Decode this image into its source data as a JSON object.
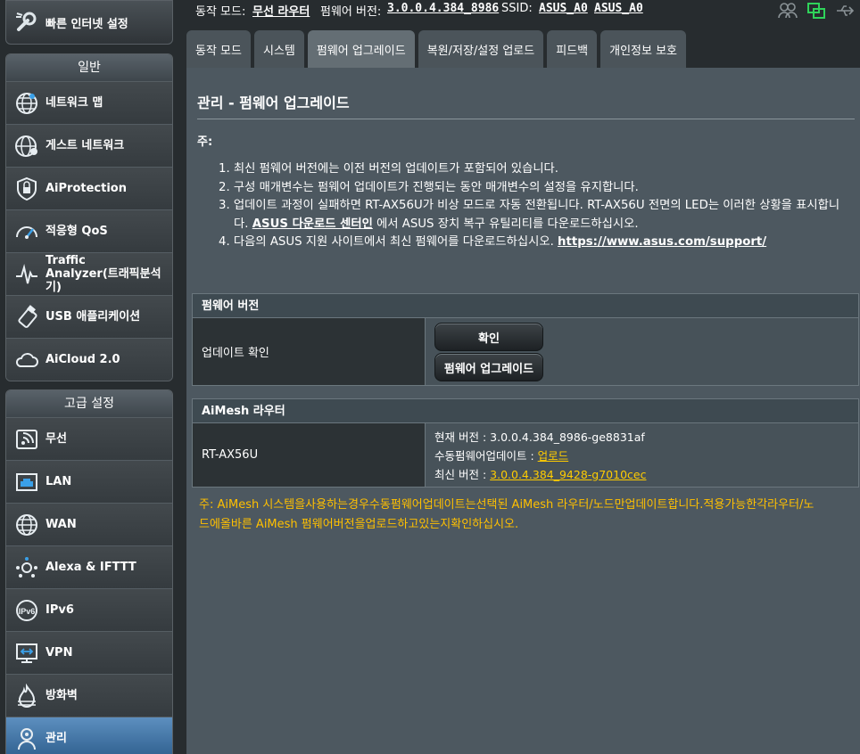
{
  "sidebar": {
    "quick_setup": "빠른 인터넷 설정",
    "general": {
      "title": "일반",
      "items": [
        {
          "label": "네트워크 맵",
          "icon": "network-map-icon"
        },
        {
          "label": "게스트 네트워크",
          "icon": "guest-network-icon"
        },
        {
          "label": "AiProtection",
          "icon": "shield-icon"
        },
        {
          "label": "적응형 QoS",
          "icon": "qos-gauge-icon"
        },
        {
          "label_line1": "Traffic",
          "label_line2": "Analyzer(트래픽분석기)",
          "icon": "traffic-analyzer-icon"
        },
        {
          "label": "USB 애플리케이션",
          "icon": "usb-icon"
        },
        {
          "label": "AiCloud 2.0",
          "icon": "cloud-icon"
        }
      ]
    },
    "advanced": {
      "title": "고급 설정",
      "items": [
        {
          "label": "무선",
          "icon": "wireless-icon"
        },
        {
          "label": "LAN",
          "icon": "lan-icon"
        },
        {
          "label": "WAN",
          "icon": "wan-globe-icon"
        },
        {
          "label": "Alexa & IFTTT",
          "icon": "alexa-ifttt-icon"
        },
        {
          "label": "IPv6",
          "icon": "ipv6-icon"
        },
        {
          "label": "VPN",
          "icon": "vpn-icon"
        },
        {
          "label": "방화벽",
          "icon": "firewall-icon"
        },
        {
          "label": "관리",
          "icon": "administration-icon"
        }
      ]
    }
  },
  "topbar": {
    "mode_label": "동작 모드:",
    "mode_value": "무선 라우터",
    "fw_label": "펌웨어 버전:",
    "fw_value": "3.0.0.4.384_8986",
    "ssid_label": "SSID:",
    "ssid_1": "ASUS_A0",
    "ssid_2": "ASUS_A0"
  },
  "tabs": [
    "동작 모드",
    "시스템",
    "펌웨어 업그레이드",
    "복원/저장/설정 업로드",
    "피드백",
    "개인정보 보호"
  ],
  "main": {
    "title": "관리 - 펌웨어 업그레이드",
    "note_label": "주:",
    "notes": {
      "n1": "1. 최신 펌웨어 버전에는 이전 버전의 업데이트가 포함되어 있습니다.",
      "n2": "2. 구성 매개변수는 펌웨어 업데이트가 진행되는 동안 매개변수의 설정을 유지합니다.",
      "n3a": "3. 업데이트 과정이 실패하면 RT-AX56U가 비상 모드로 자동 전환됩니다. RT-AX56U 전면의 LED는 이러한 상황을 표시합니",
      "n3b_pre": "다.",
      "n3b_link": "ASUS 다운로드 센터인",
      "n3b_post": "에서 ASUS 장치 복구 유틸리티를 다운로드하십시오.",
      "n4_pre": "4. 다음의 ASUS 지원 사이트에서 최신 펌웨어를 다운로드하십시오.",
      "n4_link": "https://www.asus.com/support/"
    },
    "fw_section": {
      "header": "펌웨어 버전",
      "row_label": "업데이트 확인",
      "btn_check": "확인",
      "btn_upgrade": "펌웨어 업그레이드"
    },
    "aimesh_section": {
      "header": "AiMesh 라우터",
      "router_name": "RT-AX56U",
      "current_label": "현재 버전 :",
      "current_value": "3.0.0.4.384_8986-ge8831af",
      "manual_label": "수동펌웨어업데이트 :",
      "manual_link": "업로드",
      "latest_label": "최신 버전 :",
      "latest_value": "3.0.0.4.384_9428-g7010cec"
    },
    "footnote_line1": "주: AiMesh 시스템을사용하는경우수동펌웨어업데이트는선택된 AiMesh 라우터/노드만업데이트합니다.적용가능한각라우터/노",
    "footnote_line2": "드에올바른 AiMesh 펌웨어버전을업로드하고있는지확인하십시오."
  },
  "colors": {
    "background": "#272c2f",
    "panel": "#4d5860",
    "active_nav": "#2e5e8d",
    "note_yellow": "#ffc000",
    "link_yellow": "#ffcc00"
  }
}
